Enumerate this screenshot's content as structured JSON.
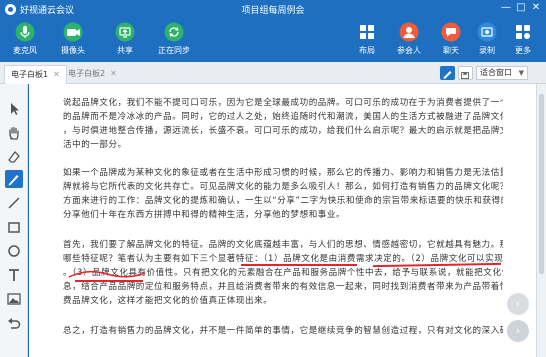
{
  "window": {
    "app_name": "好视通云会议",
    "meeting_title": "项目组每周例会"
  },
  "toolbar_left": [
    {
      "label": "麦克风",
      "icon": "microphone-icon"
    },
    {
      "label": "摄像头",
      "icon": "camera-icon"
    },
    {
      "label": "共享",
      "icon": "share-icon"
    },
    {
      "label": "正在同步",
      "icon": "sync-icon"
    }
  ],
  "toolbar_right": [
    {
      "label": "布局",
      "icon": "layout-icon"
    },
    {
      "label": "参会人",
      "icon": "participants-icon"
    },
    {
      "label": "聊天",
      "icon": "chat-icon"
    },
    {
      "label": "录制",
      "icon": "record-icon"
    },
    {
      "label": "更多",
      "icon": "more-icon"
    }
  ],
  "tabs": [
    {
      "label": "电子白板1",
      "active": true
    },
    {
      "label": "电子白板2",
      "active": false
    }
  ],
  "zoom": {
    "value": "适合窗口"
  },
  "colors": {
    "accent": "#1f6fc0",
    "annotation": "#e0262b"
  },
  "document": {
    "paragraphs": [
      [
        "说起品牌文化，我们不能不提可口可乐，因为它是全球最成功的品牌。可口可乐的成功在于为消费者提供了一个有丰富文化内涵",
        "的品牌而不是冷冰冰的产品。同时，它的过人之处，始终追随时代和潮流，美国人的生活方式被融进了品牌文化，通过长期不懈的传播",
        "，与时俱进地整合传播，源远流长，长盛不衰。可口可乐的成功，给我们什么启示呢？最大的启示就是把品牌文化变成了人们生",
        "活中的一部分。"
      ],
      [
        "如果一个品牌成为某种文化的象征或者在生活中形成习惯的时候，那么它的传播力、影响力和销售力是无法估量的，并且这个品",
        "牌就将与它所代表的文化共存亡。可见品牌文化的能力是多么吸引人！那么，如何打造有销售力的品牌文化呢？主要从如下几个",
        "方面来进行的工作：品牌文化的提炼和确认，一生以“分享”二字为快乐和使命的宗旨带来标语要的快乐和获得的时间和精力，传播同上一道，",
        "分享他们十年在东西方拼搏中和得的精神生活，分享他的梦想和事业。"
      ],
      [
        "首先，我们要了解品牌文化的特征。品牌的文化底蕴越丰富，与人们的思想、情感越密切，它就越具有魅力。那么，品牌文化有",
        "哪些特征呢？笔者认为主要有如下三个显著特征：（1）品牌文化是由消费需求决定的。（2）品牌文化可以实现多方面的认同",
        "。（3）品牌文化具有价值性。只有把文化的元素融合在产品和服务品牌个性中去，给予与联系说，就能把文化作为载体，把握现实消",
        "息，结合产品品牌的定位和服务特点，并且给消费者带来的有效信息一起来，同时找到消费者带来为产品带着情感，不断地传播到消",
        "费品牌文化，这样才能把文化的价值真正体现出来。"
      ],
      [
        "总之，打造有销售力的品牌文化，并不是一件简单的事情，它是继续竞争的智慧创造过程，只有对文化的深入研究，并并并且升"
      ]
    ]
  }
}
